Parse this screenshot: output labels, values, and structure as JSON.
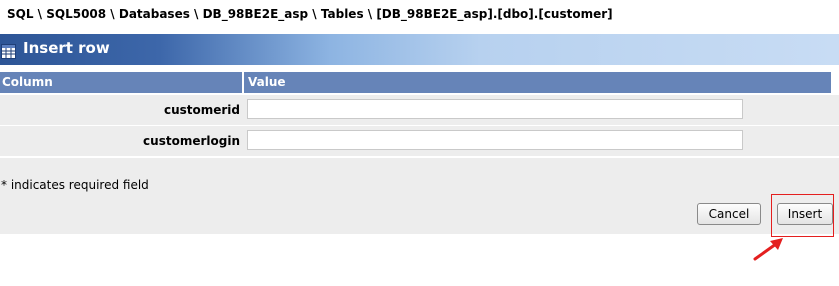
{
  "breadcrumb": "SQL \\ SQL5008 \\ Databases \\ DB_98BE2E_asp \\ Tables \\ [DB_98BE2E_asp].[dbo].[customer]",
  "header": {
    "title": "Insert row",
    "icon": "table-grid-icon"
  },
  "table": {
    "columns": [
      "Column",
      "Value"
    ],
    "rows": [
      {
        "label": "customerid",
        "value": ""
      },
      {
        "label": "customerlogin",
        "value": ""
      }
    ]
  },
  "footer": {
    "required_note": "* indicates required field",
    "cancel_label": "Cancel",
    "insert_label": "Insert"
  },
  "colors": {
    "title_gradient_start": "#2d5596",
    "title_gradient_end": "#c8dcf4",
    "column_header": "#6684b8",
    "row_background": "#ededed",
    "highlight": "#e41f1f"
  },
  "annotations": {
    "highlight_target": "insert-button",
    "arrow_icon": "red-arrow-icon"
  }
}
